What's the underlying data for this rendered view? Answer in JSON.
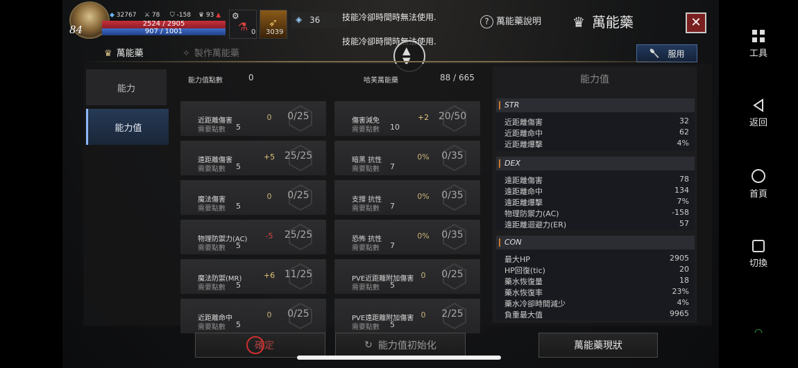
{
  "player": {
    "level": "84",
    "currency_blue": "32767",
    "stat_a": "78",
    "stat_b": "-158",
    "stat_c": "93",
    "hp": "2524 / 2905",
    "mp": "907 / 1001",
    "potion_count": "0",
    "gold_count": "3039",
    "crystal": "36"
  },
  "notices": {
    "line1": "技能冷卻時間時無法使用.",
    "line2": "技能冷卻時間時無法使用."
  },
  "header": {
    "help_label": "萬能藥說明",
    "title": "萬能藥",
    "close_icon": "close-icon"
  },
  "tabs": [
    {
      "label": "萬能藥"
    },
    {
      "label": "製作萬能藥"
    }
  ],
  "use_button": "服用",
  "left_menu": [
    {
      "label": "能力"
    },
    {
      "label": "能力值"
    }
  ],
  "summary": {
    "points_label": "能力值點數",
    "points_value": "0",
    "total_label": "哈芙萬能藥",
    "total_value": "88 / 665"
  },
  "points_prefix": "需要點數",
  "col1": [
    {
      "name": "近距離傷害",
      "points": "5",
      "bonus": "0",
      "count": "0/25"
    },
    {
      "name": "遠距離傷害",
      "points": "5",
      "bonus": "+5",
      "count": "25/25"
    },
    {
      "name": "魔法傷害",
      "points": "5",
      "bonus": "0",
      "count": "0/25"
    },
    {
      "name": "物理防禦力(AC)",
      "points": "5",
      "bonus": "-5",
      "count": "25/25"
    },
    {
      "name": "魔法防禦(MR)",
      "points": "5",
      "bonus": "+6",
      "count": "11/25"
    },
    {
      "name": "近距離命中",
      "points": "5",
      "bonus": "0",
      "count": "0/25"
    }
  ],
  "col2": [
    {
      "name": "傷害減免",
      "points": "10",
      "bonus": "+2",
      "count": "20/50"
    },
    {
      "name": "暗黑 抗性",
      "points": "7",
      "bonus": "0%",
      "count": "0/35"
    },
    {
      "name": "支撐 抗性",
      "points": "7",
      "bonus": "0%",
      "count": "0/35"
    },
    {
      "name": "恐怖 抗性",
      "points": "7",
      "bonus": "0%",
      "count": "0/35"
    },
    {
      "name": "PVE近距離附加傷害",
      "points": "5",
      "bonus": "0",
      "count": "0/25"
    },
    {
      "name": "PVE遠距離附加傷害",
      "points": "5",
      "bonus": "0",
      "count": "2/25"
    }
  ],
  "stats_panel": {
    "title": "能力值",
    "str": {
      "header": "STR",
      "rows": [
        {
          "label": "近距離傷害",
          "value": "32"
        },
        {
          "label": "近距離命中",
          "value": "62"
        },
        {
          "label": "近距離爆擊",
          "value": "4%"
        }
      ]
    },
    "dex": {
      "header": "DEX",
      "rows": [
        {
          "label": "遠距離傷害",
          "value": "78"
        },
        {
          "label": "遠距離命中",
          "value": "134"
        },
        {
          "label": "遠距離爆擊",
          "value": "7%"
        },
        {
          "label": "物理防禦力(AC)",
          "value": "-158"
        },
        {
          "label": "遠距離迴避力(ER)",
          "value": "57"
        }
      ]
    },
    "con": {
      "header": "CON",
      "rows": [
        {
          "label": "最大HP",
          "value": "2905"
        },
        {
          "label": "HP回復(tic)",
          "value": "20"
        },
        {
          "label": "藥水恢復量",
          "value": "18"
        },
        {
          "label": "藥水恢復率",
          "value": "23%"
        },
        {
          "label": "藥水冷卻時間減少",
          "value": "4%"
        },
        {
          "label": "負重最大值",
          "value": "9965"
        }
      ]
    }
  },
  "bottom": {
    "confirm": "確定",
    "reset": "能力值初始化",
    "status": "萬能藥現狀"
  },
  "navbar": {
    "tools": "工具",
    "back": "返回",
    "home": "首頁",
    "switch": "切換"
  },
  "colors": {
    "accent_gold": "#c8b27a",
    "negative": "#d9473d",
    "active_blue": "#8fb8ff"
  }
}
